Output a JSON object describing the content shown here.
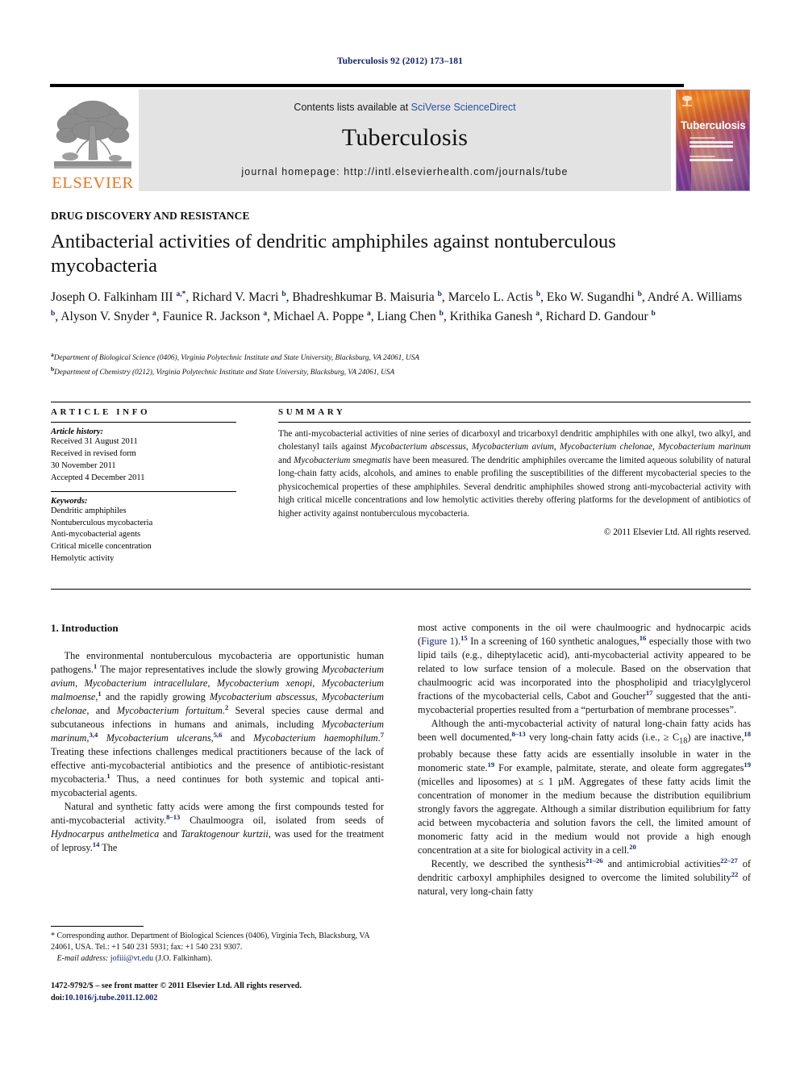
{
  "running_head": "Tuberculosis 92 (2012) 173–181",
  "masthead": {
    "contents_prefix": "Contents lists available at ",
    "contents_link": "SciVerse ScienceDirect",
    "journal_name": "Tuberculosis",
    "homepage_label": "journal homepage: http://intl.elsevierhealth.com/journals/tube",
    "publisher_logo_text": "ELSEVIER",
    "cover_title": "Tuberculosis"
  },
  "section_tag": "DRUG DISCOVERY AND RESISTANCE",
  "title": "Antibacterial activities of dendritic amphiphiles against nontuberculous mycobacteria",
  "authors_html": "Joseph O. Falkinham III <sup>a,*</sup>, Richard V. Macri <sup>b</sup>, Bhadreshkumar B. Maisuria <sup>b</sup>, Marcelo L. Actis <sup>b</sup>, Eko W. Sugandhi <sup>b</sup>, André A. Williams <sup>b</sup>, Alyson V. Snyder <sup>a</sup>, Faunice R. Jackson <sup>a</sup>, Michael A. Poppe <sup>a</sup>, Liang Chen <sup>b</sup>, Krithika Ganesh <sup>a</sup>, Richard D. Gandour <sup>b</sup>",
  "affiliations": [
    "Department of Biological Science (0406), Virginia Polytechnic Institute and State University, Blacksburg, VA 24061, USA",
    "Department of Chemistry (0212), Virginia Polytechnic Institute and State University, Blacksburg, VA 24061, USA"
  ],
  "affiliation_marks": [
    "a",
    "b"
  ],
  "article_info": {
    "heading": "ARTICLE INFO",
    "history_label": "Article history:",
    "history": [
      "Received 31 August 2011",
      "Received in revised form",
      "30 November 2011",
      "Accepted 4 December 2011"
    ],
    "keywords_label": "Keywords:",
    "keywords": [
      "Dendritic amphiphiles",
      "Nontuberculous mycobacteria",
      "Anti-mycobacterial agents",
      "Critical micelle concentration",
      "Hemolytic activity"
    ]
  },
  "summary": {
    "heading": "SUMMARY",
    "body_html": "The anti-mycobacterial activities of nine series of dicarboxyl and tricarboxyl dendritic amphiphiles with one alkyl, two alkyl, and cholestanyl tails against <i>Mycobacterium abscessus</i>, <i>Mycobacterium avium</i>, <i>Mycobacterium chelonae</i>, <i>Mycobacterium marinum</i> and <i>Mycobacterium smegmatis</i> have been measured. The dendritic amphiphiles overcame the limited aqueous solubility of natural long-chain fatty acids, alcohols, and amines to enable profiling the susceptibilities of the different mycobacterial species to the physicochemical properties of these amphiphiles. Several dendritic amphiphiles showed strong anti-mycobacterial activity with high critical micelle concentrations and low hemolytic activities thereby offering platforms for the development of antibiotics of higher activity against nontuberculous mycobacteria.",
    "copyright": "© 2011 Elsevier Ltd. All rights reserved."
  },
  "body": {
    "intro_heading": "1. Introduction",
    "left_paragraphs_html": [
      "The environmental nontuberculous mycobacteria are opportunistic human pathogens.<sup>1</sup> The major representatives include the slowly growing <i>Mycobacterium avium</i>, <i>Mycobacterium intracellulare</i>, <i>Mycobacterium xenopi</i>, <i>Mycobacterium malmoense</i>,<sup>1</sup> and the rapidly growing <i>Mycobacterium abscessus</i>, <i>Mycobacterium chelonae</i>, and <i>Mycobacterium fortuitum</i>.<sup>2</sup> Several species cause dermal and subcutaneous infections in humans and animals, including <i>Mycobacterium marinum</i>,<sup>3,4</sup> <i>Mycobacterium ulcerans</i>,<sup>5,6</sup> and <i>Mycobacterium haemophilum</i>.<sup>7</sup> Treating these infections challenges medical practitioners because of the lack of effective anti-mycobacterial antibiotics and the presence of antibiotic-resistant mycobacteria.<sup>1</sup> Thus, a need continues for both systemic and topical anti-mycobacterial agents.",
      "Natural and synthetic fatty acids were among the first compounds tested for anti-mycobacterial activity.<sup>8–13</sup> Chaulmoogra oil, isolated from seeds of <i>Hydnocarpus anthelmetica</i> and <i>Taraktogenour kurtzii</i>, was used for the treatment of leprosy.<sup>14</sup> The"
    ],
    "right_paragraphs_html": [
      "most active components in the oil were chaulmoogric and hydnocarpic acids (<span class=\"ref-link\">Figure 1</span>).<sup>15</sup> In a screening of 160 synthetic analogues,<sup>16</sup> especially those with two lipid tails (e.g., diheptylacetic acid), anti-mycobacterial activity appeared to be related to low surface tension of a molecule. Based on the observation that chaulmoogric acid was incorporated into the phospholipid and triacylglycerol fractions of the mycobacterial cells, Cabot and Goucher<sup>17</sup> suggested that the anti-mycobacterial properties resulted from a &ldquo;perturbation of membrane processes&rdquo;.",
      "Although the anti-mycobacterial activity of natural long-chain fatty acids has been well documented,<sup>8–13</sup> very long-chain fatty acids (i.e., &ge; C<sub>18</sub>) are inactive,<sup>18</sup> probably because these fatty acids are essentially insoluble in water in the monomeric state.<sup>19</sup> For example, palmitate, sterate, and oleate form aggregates<sup>19</sup> (micelles and liposomes) at &le; 1 &micro;M. Aggregates of these fatty acids limit the concentration of monomer in the medium because the distribution equilibrium strongly favors the aggregate. Although a similar distribution equilibrium for fatty acid between mycobacteria and solution favors the cell, the limited amount of monomeric fatty acid in the medium would not provide a high enough concentration at a site for biological activity in a cell.<sup>20</sup>",
      "Recently, we described the synthesis<sup>21–26</sup> and antimicrobial activities<sup>22–27</sup> of dendritic carboxyl amphiphiles designed to overcome the limited solubility<sup>22</sup> of natural, very long-chain fatty"
    ]
  },
  "footnote_html": "* Corresponding author. Department of Biological Sciences (0406), Virginia Tech, Blacksburg, VA 24061, USA. Tel.: +1 540 231 5931; fax: +1 540 231 9307.",
  "footnote_email_label": "E-mail address:",
  "footnote_email": "jofiii@vt.edu",
  "footnote_email_owner": "(J.O. Falkinham).",
  "imprint_line": "1472-9792/$ – see front matter © 2011 Elsevier Ltd. All rights reserved.",
  "imprint_doi_label": "doi:",
  "imprint_doi": "10.1016/j.tube.2011.12.002"
}
